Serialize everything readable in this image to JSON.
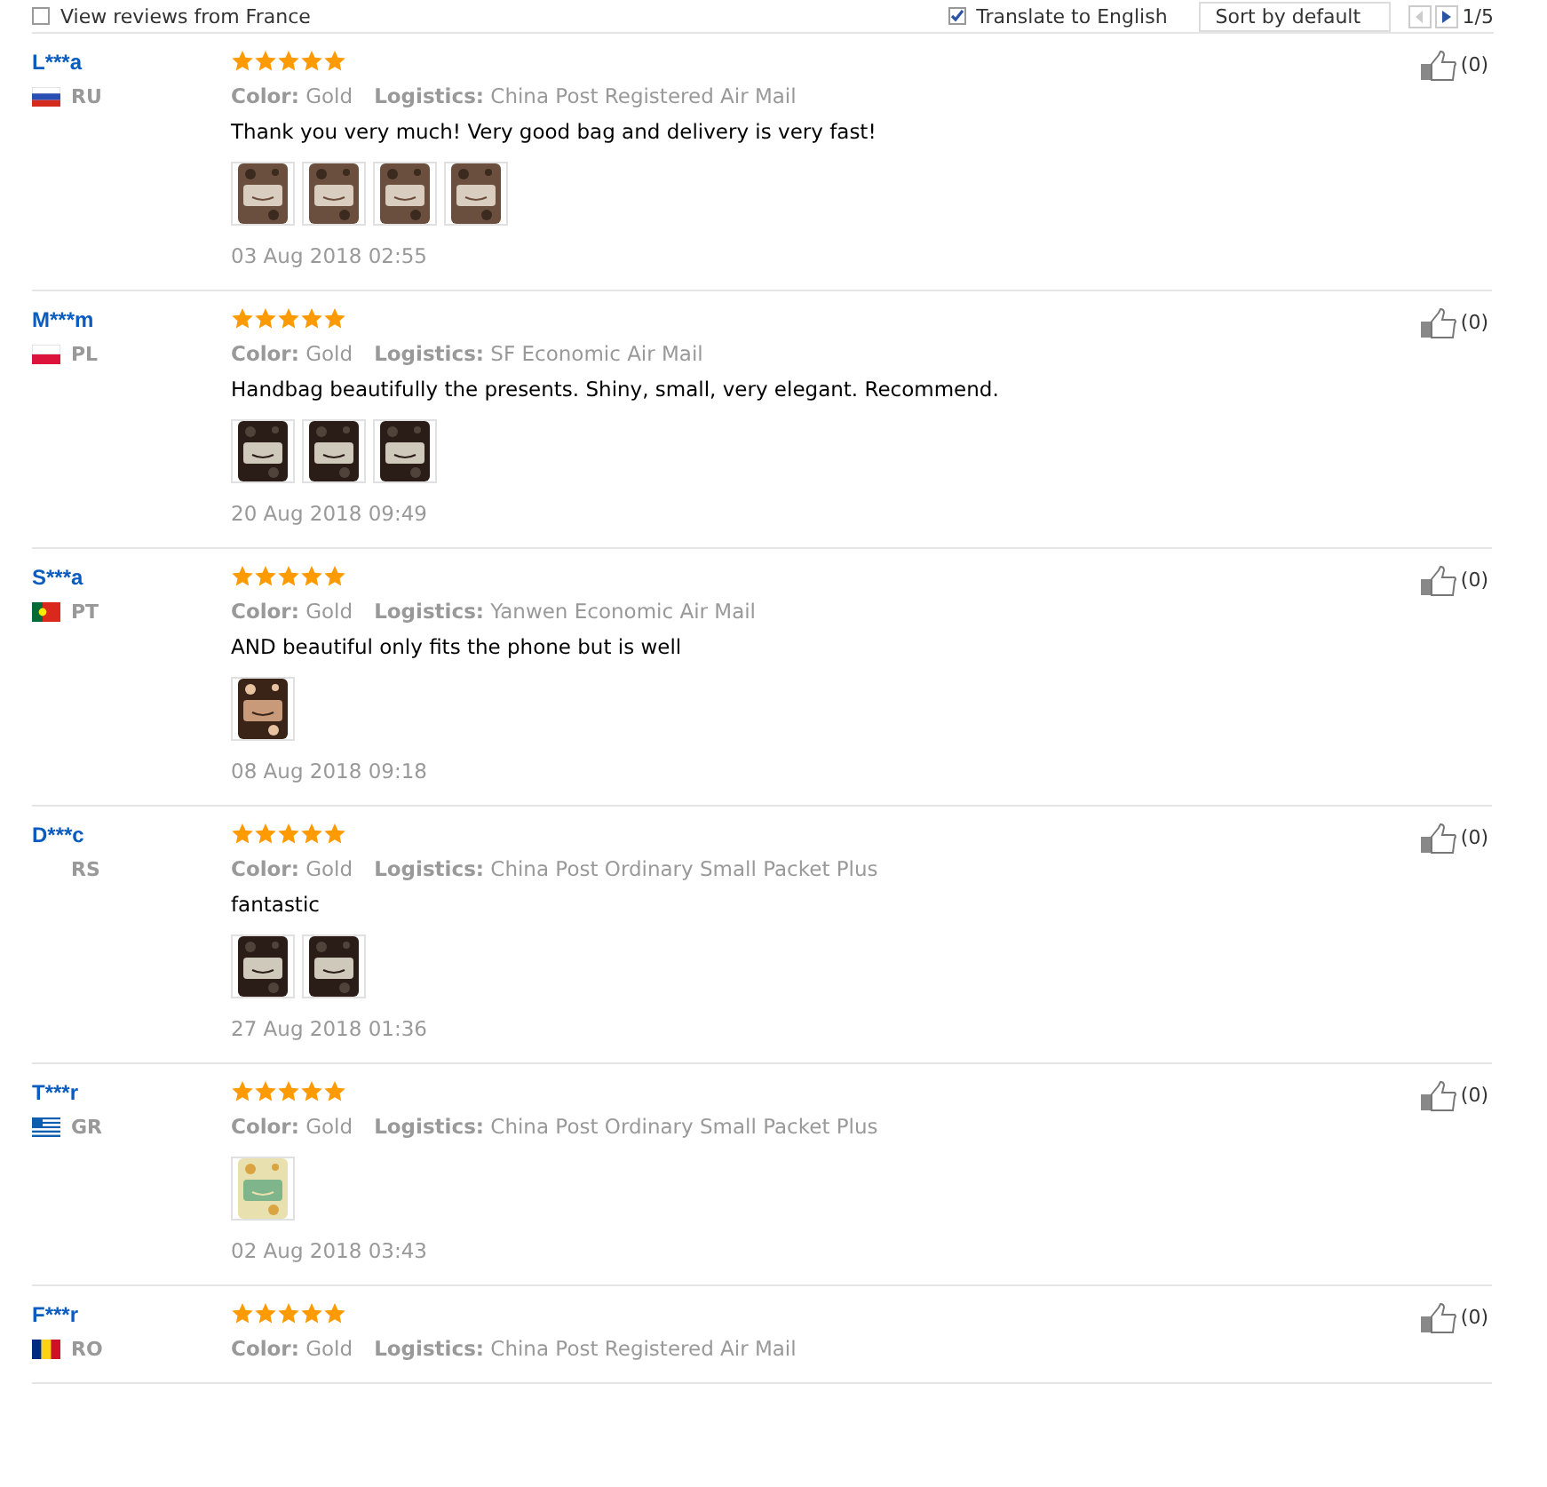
{
  "toolbar": {
    "france_filter": {
      "label": "View reviews from France",
      "checked": false
    },
    "translate": {
      "label": "Translate to English",
      "checked": true
    },
    "sort": {
      "value": "Sort by default"
    },
    "page": "1/5"
  },
  "reviews": [
    {
      "name": "L***a",
      "flag": {
        "kind": "ru"
      },
      "country": "RU",
      "stars": 5,
      "color_label": "Color:",
      "color_value": "Gold",
      "logistics_label": "Logistics:",
      "logistics": "China Post Registered Air Mail",
      "text": "Thank you very much! Very good bag and delivery is very fast!",
      "photos": [
        {
          "kind": "picture"
        },
        {
          "kind": "picture"
        },
        {
          "kind": "picture"
        },
        {
          "kind": "picture"
        }
      ],
      "date": "03 Aug 2018 02:55",
      "likes": "(0)"
    },
    {
      "name": "M***m",
      "flag": {
        "kind": "pl"
      },
      "country": "PL",
      "stars": 5,
      "color_label": "Color:",
      "color_value": "Gold",
      "logistics_label": "Logistics:",
      "logistics": "SF Economic Air Mail",
      "text": "Handbag beautifully the presents. Shiny, small, very elegant. Recommend.",
      "photos": [
        {
          "kind": "picture"
        },
        {
          "kind": "picture"
        },
        {
          "kind": "picture"
        }
      ],
      "date": "20 Aug 2018 09:49",
      "likes": "(0)"
    },
    {
      "name": "S***a",
      "flag": {
        "kind": "pt"
      },
      "country": "PT",
      "stars": 5,
      "color_label": "Color:",
      "color_value": "Gold",
      "logistics_label": "Logistics:",
      "logistics": "Yanwen Economic Air Mail",
      "text": "AND beautiful only fits the phone but is well",
      "photos": [
        {
          "kind": "picture"
        }
      ],
      "date": "08 Aug 2018 09:18",
      "likes": "(0)"
    },
    {
      "name": "D***c",
      "country": "RS",
      "stars": 5,
      "color_label": "Color:",
      "color_value": "Gold",
      "logistics_label": "Logistics:",
      "logistics": "China Post Ordinary Small Packet Plus",
      "text": "fantastic",
      "photos": [
        {
          "kind": "picture"
        },
        {
          "kind": "picture"
        }
      ],
      "date": "27 Aug 2018 01:36",
      "likes": "(0)"
    },
    {
      "name": "T***r",
      "flag": {
        "kind": "gr"
      },
      "country": "GR",
      "stars": 5,
      "color_label": "Color:",
      "color_value": "Gold",
      "logistics_label": "Logistics:",
      "logistics": "China Post Ordinary Small Packet Plus",
      "photos": [
        {
          "kind": "picture"
        }
      ],
      "date": "02 Aug 2018 03:43",
      "likes": "(0)"
    },
    {
      "name": "F***r",
      "flag": {
        "kind": "ro"
      },
      "country": "RO",
      "stars": 5,
      "color_label": "Color:",
      "color_value": "Gold",
      "logistics_label": "Logistics:",
      "logistics": "China Post Registered Air Mail",
      "likes": "(0)"
    }
  ]
}
